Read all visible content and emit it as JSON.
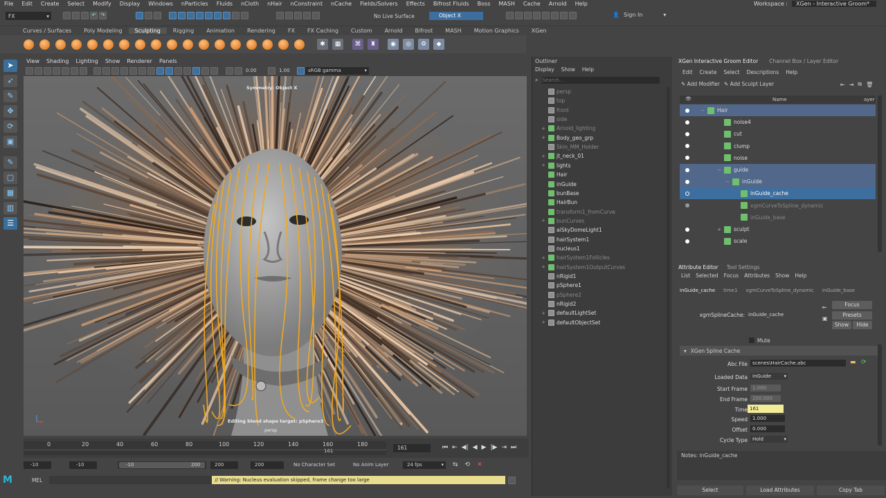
{
  "menubar": {
    "items": [
      "File",
      "Edit",
      "Create",
      "Select",
      "Modify",
      "Display",
      "Windows",
      "nParticles",
      "Fluids",
      "nCloth",
      "nHair",
      "nConstraint",
      "nCache",
      "Fields/Solvers",
      "Effects",
      "Bifrost Fluids",
      "Boss",
      "MASH",
      "Cache",
      "Arnold",
      "Help"
    ],
    "workspace_label": "Workspace :",
    "workspace_value": "XGen - Interactive Groom*"
  },
  "statusline": {
    "mode": "FX",
    "live_surface": "No Live Surface",
    "symmetry_field": "Object X",
    "sign_in": "Sign In"
  },
  "shelf": {
    "tabs": [
      "Curves / Surfaces",
      "Poly Modeling",
      "Sculpting",
      "Rigging",
      "Animation",
      "Rendering",
      "FX",
      "FX Caching",
      "Custom",
      "Arnold",
      "Bifrost",
      "MASH",
      "Motion Graphics",
      "XGen"
    ],
    "active_tab": "Sculpting"
  },
  "viewport": {
    "menu": [
      "View",
      "Shading",
      "Lighting",
      "Show",
      "Renderer",
      "Panels"
    ],
    "exposure": "0.00",
    "gamma": "1.00",
    "color_space": "sRGB gamma",
    "symmetry_hud": "Symmetry: Object X",
    "edit_hud": "Editing blend shape target: pSphere3",
    "camera": "persp"
  },
  "timeline": {
    "ticks": [
      "0",
      "20",
      "40",
      "60",
      "80",
      "100",
      "120",
      "140",
      "160",
      "180"
    ],
    "current_frame_marker": "161",
    "current_frame": "161",
    "range_start": "-10",
    "anim_start": "-10",
    "slider_start": "-10",
    "slider_end": "200",
    "anim_end": "200",
    "range_end": "200",
    "character_set": "No Character Set",
    "anim_layer": "No Anim Layer",
    "fps": "24 fps"
  },
  "mel": {
    "label": "MEL",
    "warning": "// Warning: Nucleus evaluation skipped, frame change too large"
  },
  "outliner": {
    "title": "Outliner",
    "menu": [
      "Display",
      "Show",
      "Help"
    ],
    "search_placeholder": "Search...",
    "items": [
      {
        "label": "persp",
        "dim": true,
        "exp": ""
      },
      {
        "label": "top",
        "dim": true,
        "exp": ""
      },
      {
        "label": "front",
        "dim": true,
        "exp": ""
      },
      {
        "label": "side",
        "dim": true,
        "exp": ""
      },
      {
        "label": "Arnold_lighting",
        "dim": true,
        "exp": "+"
      },
      {
        "label": "Body_geo_grp",
        "dim": false,
        "exp": "+"
      },
      {
        "label": "Skin_MM_Holder",
        "dim": true,
        "exp": ""
      },
      {
        "label": "jt_neck_01",
        "dim": false,
        "exp": "+"
      },
      {
        "label": "lights",
        "dim": false,
        "exp": "+"
      },
      {
        "label": "Hair",
        "dim": false,
        "exp": ""
      },
      {
        "label": "inGuide",
        "dim": false,
        "exp": ""
      },
      {
        "label": "bunBase",
        "dim": false,
        "exp": ""
      },
      {
        "label": "HairBun",
        "dim": false,
        "exp": ""
      },
      {
        "label": "transform1_fromCurve",
        "dim": true,
        "exp": ""
      },
      {
        "label": "bunCurves",
        "dim": true,
        "exp": "+"
      },
      {
        "label": "aiSkyDomeLight1",
        "dim": false,
        "exp": ""
      },
      {
        "label": "hairSystem1",
        "dim": false,
        "exp": ""
      },
      {
        "label": "nucleus1",
        "dim": false,
        "exp": ""
      },
      {
        "label": "hairSystem1Follicles",
        "dim": true,
        "exp": "+"
      },
      {
        "label": "hairSystem1OutputCurves",
        "dim": true,
        "exp": "+"
      },
      {
        "label": "nRigid1",
        "dim": false,
        "exp": ""
      },
      {
        "label": "pSphere1",
        "dim": false,
        "exp": ""
      },
      {
        "label": "pSphere2",
        "dim": true,
        "exp": ""
      },
      {
        "label": "nRigid2",
        "dim": false,
        "exp": ""
      },
      {
        "label": "defaultLightSet",
        "dim": false,
        "exp": "+"
      },
      {
        "label": "defaultObjectSet",
        "dim": false,
        "exp": "+"
      }
    ]
  },
  "xgen": {
    "tabs": [
      "XGen Interactive Groom Editor",
      "Channel Box / Layer Editor"
    ],
    "menu": [
      "Edit",
      "Create",
      "Select",
      "Descriptions",
      "Help"
    ],
    "add_modifier": "Add Modifier",
    "add_sculpt_layer": "Add Sculpt Layer",
    "col_name": "Name",
    "col_layer": "ayer",
    "rows": [
      {
        "label": "Hair",
        "indent": 0,
        "exp": "−",
        "eye": "on",
        "state": "sel"
      },
      {
        "label": "noise4",
        "indent": 2,
        "exp": "",
        "eye": "on",
        "state": ""
      },
      {
        "label": "cut",
        "indent": 2,
        "exp": "",
        "eye": "on",
        "state": ""
      },
      {
        "label": "clump",
        "indent": 2,
        "exp": "",
        "eye": "on",
        "state": ""
      },
      {
        "label": "noise",
        "indent": 2,
        "exp": "",
        "eye": "on",
        "state": ""
      },
      {
        "label": "guide",
        "indent": 2,
        "exp": "−",
        "eye": "on",
        "state": "sel"
      },
      {
        "label": "inGuide",
        "indent": 3,
        "exp": "−",
        "eye": "on",
        "state": "sel"
      },
      {
        "label": "inGuide_cache",
        "indent": 4,
        "exp": "",
        "eye": "hollow",
        "state": "hl"
      },
      {
        "label": "xgmCurveToSpline_dynamic",
        "indent": 4,
        "exp": "",
        "eye": "off",
        "state": "dim"
      },
      {
        "label": "inGuide_base",
        "indent": 4,
        "exp": "",
        "eye": "",
        "state": "dim"
      },
      {
        "label": "sculpt",
        "indent": 2,
        "exp": "+",
        "eye": "on",
        "state": ""
      },
      {
        "label": "scale",
        "indent": 2,
        "exp": "",
        "eye": "on",
        "state": ""
      }
    ]
  },
  "attr": {
    "tabs": [
      "Attribute Editor",
      "Tool Settings"
    ],
    "menu": [
      "List",
      "Selected",
      "Focus",
      "Attributes",
      "Show",
      "Help"
    ],
    "node_tabs": [
      "inGuide_cache",
      "time1",
      "xgmCurveToSpline_dynamic",
      "inGuide_base"
    ],
    "node_label": "xgmSplineCache:",
    "node_value": "inGuide_cache",
    "focus": "Focus",
    "presets": "Presets",
    "show": "Show",
    "hide": "Hide",
    "mute": "Mute",
    "section": "XGen Spline Cache",
    "abc_file_label": "Abc File",
    "abc_file": "scenes\\HairCache.abc",
    "loaded_data_label": "Loaded Data",
    "loaded_data": "inGuide",
    "start_frame_label": "Start Frame",
    "start_frame": "1.000",
    "end_frame_label": "End Frame",
    "end_frame": "200.000",
    "time_label": "Time",
    "time": "161",
    "speed_label": "Speed",
    "speed": "1.000",
    "offset_label": "Offset",
    "offset": "0.000",
    "cycle_type_label": "Cycle Type",
    "cycle_type": "Hold",
    "notes": "Notes:  inGuide_cache",
    "buttons": [
      "Select",
      "Load Attributes",
      "Copy Tab"
    ]
  }
}
